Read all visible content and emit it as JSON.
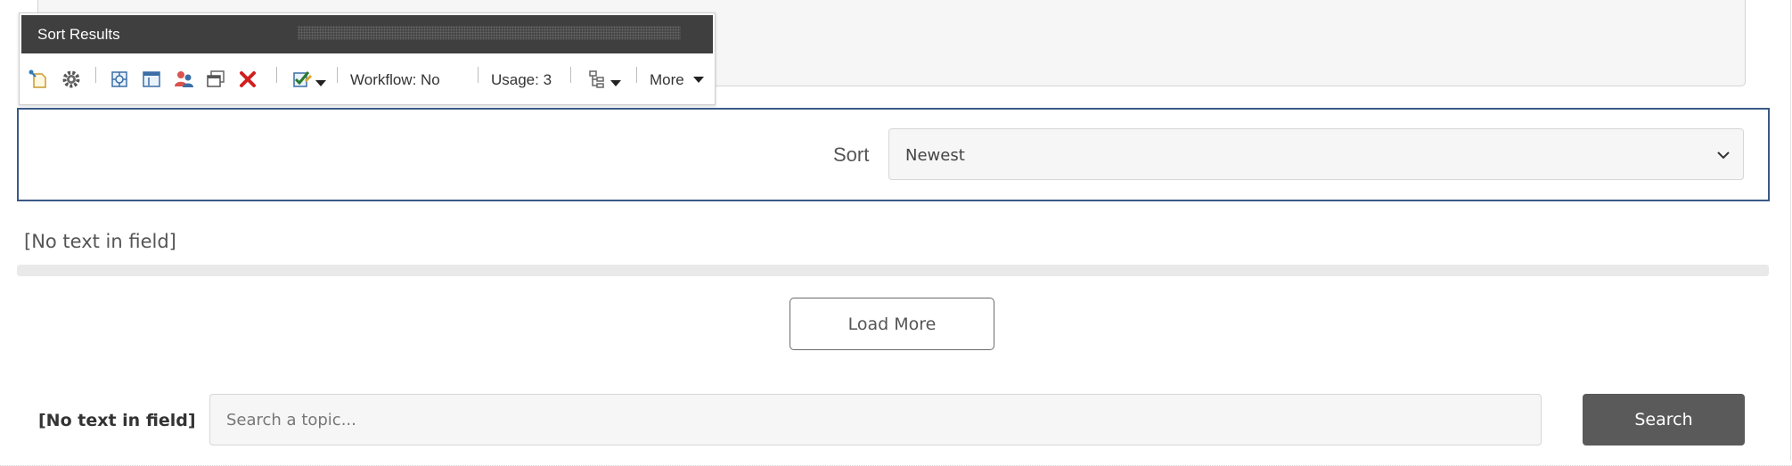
{
  "toolbar": {
    "title": "Sort Results",
    "workflow": "Workflow: No",
    "usage": "Usage: 3",
    "more": "More",
    "icons": [
      "insert-icon",
      "settings-gear-icon",
      "target-icon",
      "edit-layout-icon",
      "personalize-users-icon",
      "window-icon",
      "delete-x-icon",
      "check-edit-icon",
      "hierarchy-icon"
    ]
  },
  "sort": {
    "label": "Sort",
    "selected": "Newest"
  },
  "field_placeholder_1": "[No text in field]",
  "load_more_label": "Load More",
  "field_placeholder_2": "[No text in field]",
  "search": {
    "placeholder": "Search a topic...",
    "button_label": "Search"
  },
  "colors": {
    "toolbar_header": "#3f3f3f",
    "sort_border": "#3a5a86",
    "search_button": "#5a5a5a",
    "delete_icon": "#d11f1f"
  }
}
